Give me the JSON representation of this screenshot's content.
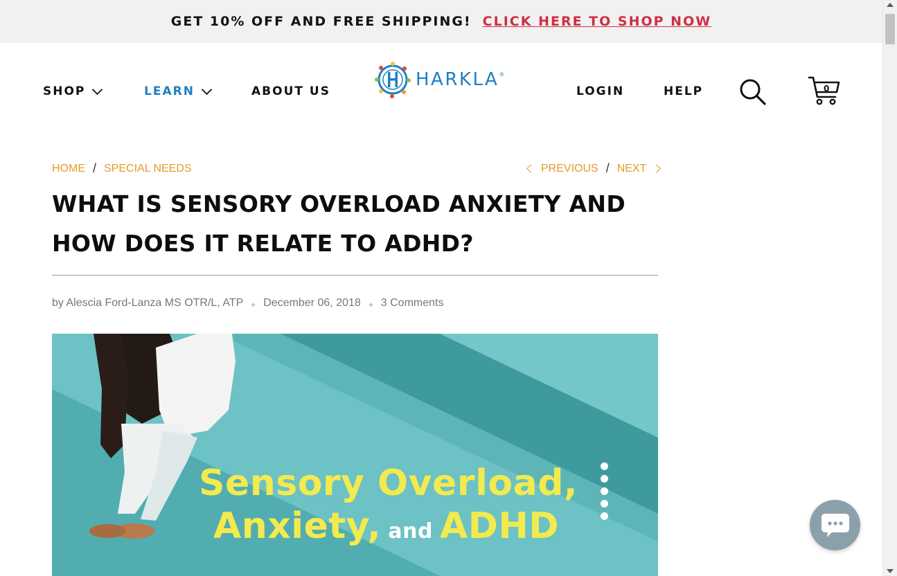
{
  "promo": {
    "lead": "GET 10% OFF AND FREE SHIPPING!",
    "cta": "CLICK HERE TO SHOP NOW"
  },
  "nav": {
    "shop": "SHOP",
    "learn": "LEARN",
    "about": "ABOUT US",
    "login": "LOGIN",
    "help": "HELP"
  },
  "logo": {
    "word": "HARKLA",
    "reg": "®"
  },
  "cart": {
    "count": "0"
  },
  "breadcrumb": {
    "home": "HOME",
    "sep": "/",
    "category": "SPECIAL NEEDS"
  },
  "pager": {
    "previous": "PREVIOUS",
    "sep": "/",
    "next": "NEXT"
  },
  "article": {
    "title": "WHAT IS SENSORY OVERLOAD ANXIETY AND HOW DOES IT RELATE TO ADHD?",
    "author": "by Alescia Ford-Lanza MS OTR/L, ATP",
    "date": "December 06, 2018",
    "comments": "3 Comments"
  },
  "hero": {
    "line1": "Sensory Overload,",
    "line2_a": "Anxiety,",
    "line2_b": "and",
    "line2_c": "ADHD"
  },
  "colors": {
    "accent_blue": "#1e7fc3",
    "promo_red": "#cf2e42",
    "breadcrumb_orange": "#e39a2b",
    "hero_teal": "#5fb7b9",
    "hero_yellow": "#f3ea4f"
  },
  "icons": {
    "search": "search-icon",
    "cart": "cart-icon",
    "chat": "chat-icon"
  }
}
